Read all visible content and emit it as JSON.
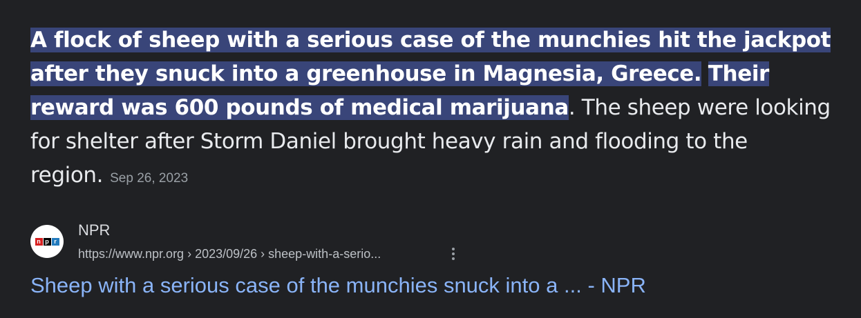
{
  "snippet": {
    "highlight_1": "A flock of sheep with a serious case of the munchies hit the jackpot after they snuck into a greenhouse in Magnesia, Greece.",
    "highlight_2": "Their reward was 600 pounds of medical marijuana",
    "rest": ". The sheep were looking for shelter after Storm Daniel brought heavy rain and flooding to the region.",
    "date": "Sep 26, 2023"
  },
  "source": {
    "logo_letters": [
      "n",
      "p",
      "r"
    ],
    "logo_colors": [
      "#d62021",
      "#000000",
      "#237bbd"
    ],
    "name": "NPR",
    "url": "https://www.npr.org › 2023/09/26 › sheep-with-a-serio...",
    "more_icon": "three-dots-vertical-icon"
  },
  "result": {
    "title": "Sheep with a serious case of the munchies snuck into a ... - NPR"
  },
  "colors": {
    "background": "#202124",
    "highlight": "#394579",
    "link": "#8ab4f8"
  }
}
